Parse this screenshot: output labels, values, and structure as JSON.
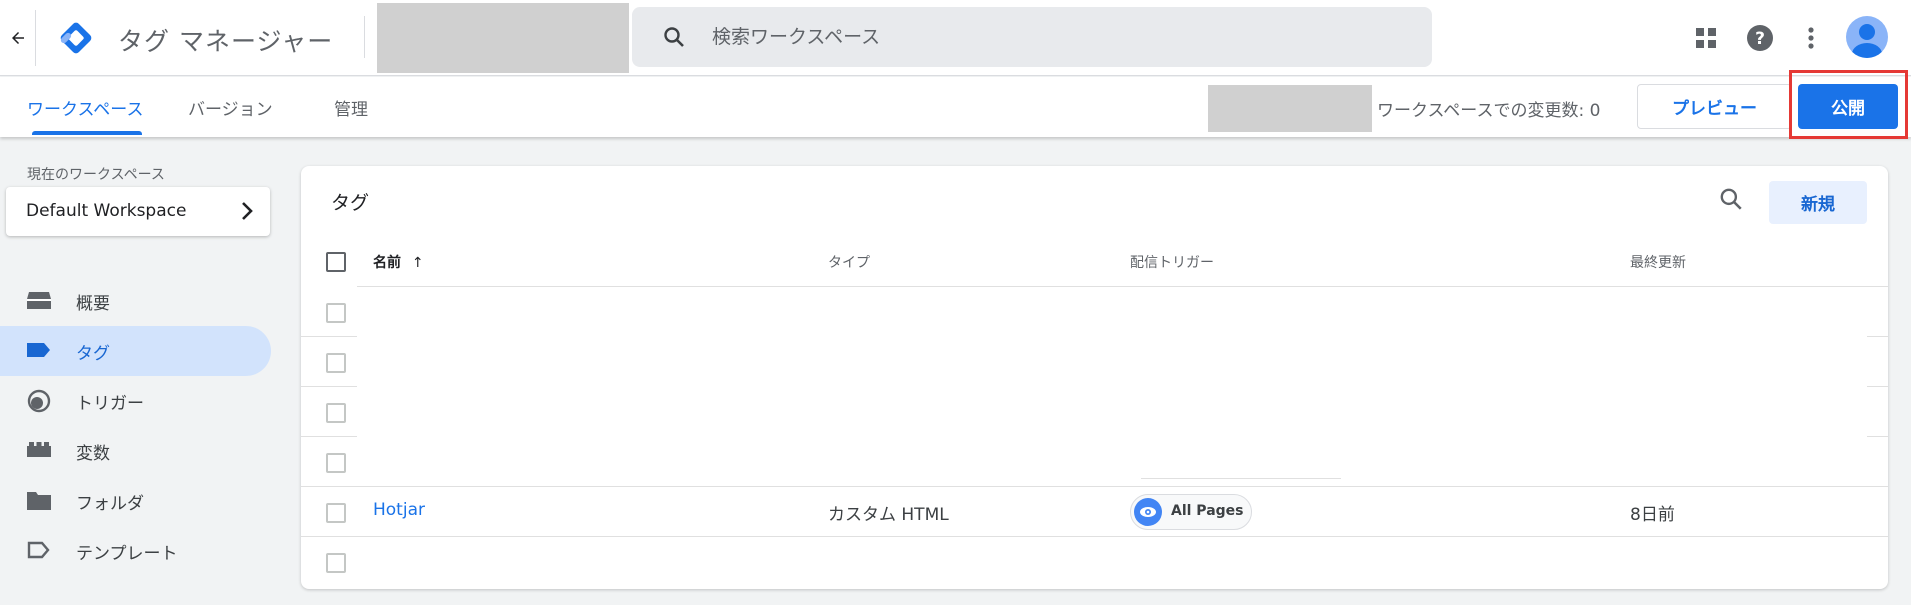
{
  "app": {
    "product_name": "タグ マネージャー",
    "search_placeholder": "検索ワークスペース"
  },
  "subnav": {
    "tabs": [
      {
        "label": "ワークスペース",
        "active": true
      },
      {
        "label": "バージョン",
        "active": false
      },
      {
        "label": "管理",
        "active": false
      }
    ],
    "changes_label": "ワークスペースでの変更数: 0",
    "preview_label": "プレビュー",
    "publish_label": "公開"
  },
  "sidebar": {
    "current_workspace_label": "現在のワークスペース",
    "workspace_name": "Default Workspace",
    "items": [
      {
        "label": "概要",
        "icon": "overview-icon",
        "active": false
      },
      {
        "label": "タグ",
        "icon": "tag-icon",
        "active": true
      },
      {
        "label": "トリガー",
        "icon": "trigger-icon",
        "active": false
      },
      {
        "label": "変数",
        "icon": "variable-icon",
        "active": false
      },
      {
        "label": "フォルダ",
        "icon": "folder-icon",
        "active": false
      },
      {
        "label": "テンプレート",
        "icon": "template-icon",
        "active": false
      }
    ]
  },
  "tags_table": {
    "title": "タグ",
    "new_label": "新規",
    "columns": [
      "名前",
      "タイプ",
      "配信トリガー",
      "最終更新"
    ],
    "sort_indicator": "↑",
    "rows": [
      {
        "name": "Hotjar",
        "type": "カスタム HTML",
        "trigger": "All Pages",
        "updated": "8日前"
      }
    ]
  },
  "colors": {
    "accent": "#1a73e8",
    "highlight_frame": "#e53935"
  }
}
